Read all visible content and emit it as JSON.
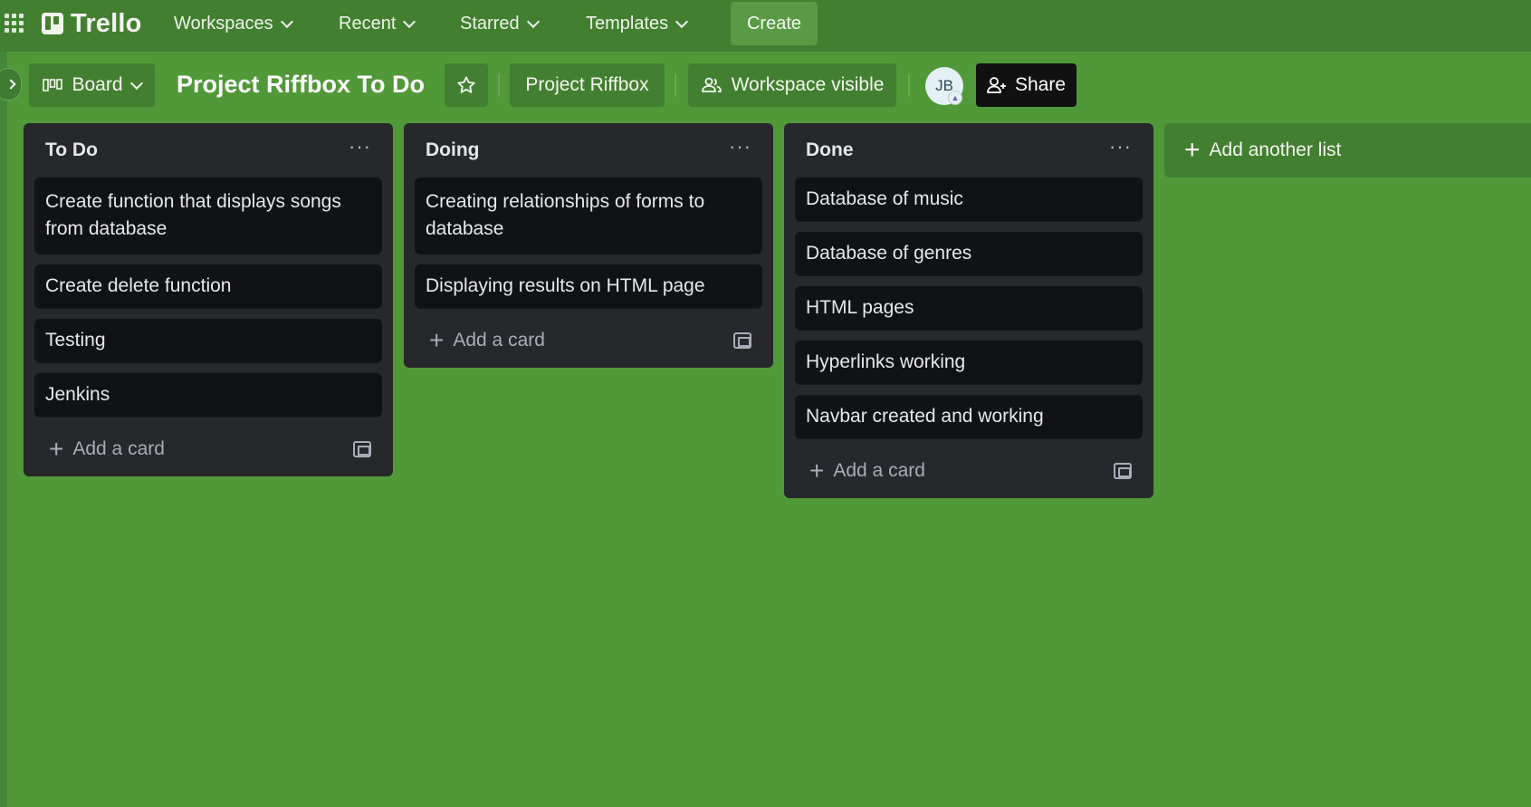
{
  "topnav": {
    "logo": "Trello",
    "menus": [
      {
        "label": "Workspaces"
      },
      {
        "label": "Recent"
      },
      {
        "label": "Starred"
      },
      {
        "label": "Templates"
      }
    ],
    "create_label": "Create"
  },
  "board": {
    "view_label": "Board",
    "title": "Project Riffbox To Do",
    "workspace": "Project Riffbox",
    "visibility": "Workspace visible",
    "avatar_initials": "JB",
    "share_label": "Share"
  },
  "lists": [
    {
      "title": "To Do",
      "cards": [
        "Create function that displays songs from database",
        "Create delete function",
        "Testing",
        "Jenkins"
      ],
      "add_card_label": "Add a card"
    },
    {
      "title": "Doing",
      "cards": [
        "Creating relationships of forms to database",
        "Displaying results on HTML page"
      ],
      "add_card_label": "Add a card"
    },
    {
      "title": "Done",
      "cards": [
        "Database of music",
        "Database of genres",
        "HTML pages",
        "Hyperlinks working",
        "Navbar created and working"
      ],
      "add_card_label": "Add a card"
    }
  ],
  "add_list_label": "Add another list",
  "colors": {
    "board_bg": "#519839",
    "nav_bg": "#437f31",
    "list_bg": "#27282c",
    "card_bg": "#111214"
  }
}
